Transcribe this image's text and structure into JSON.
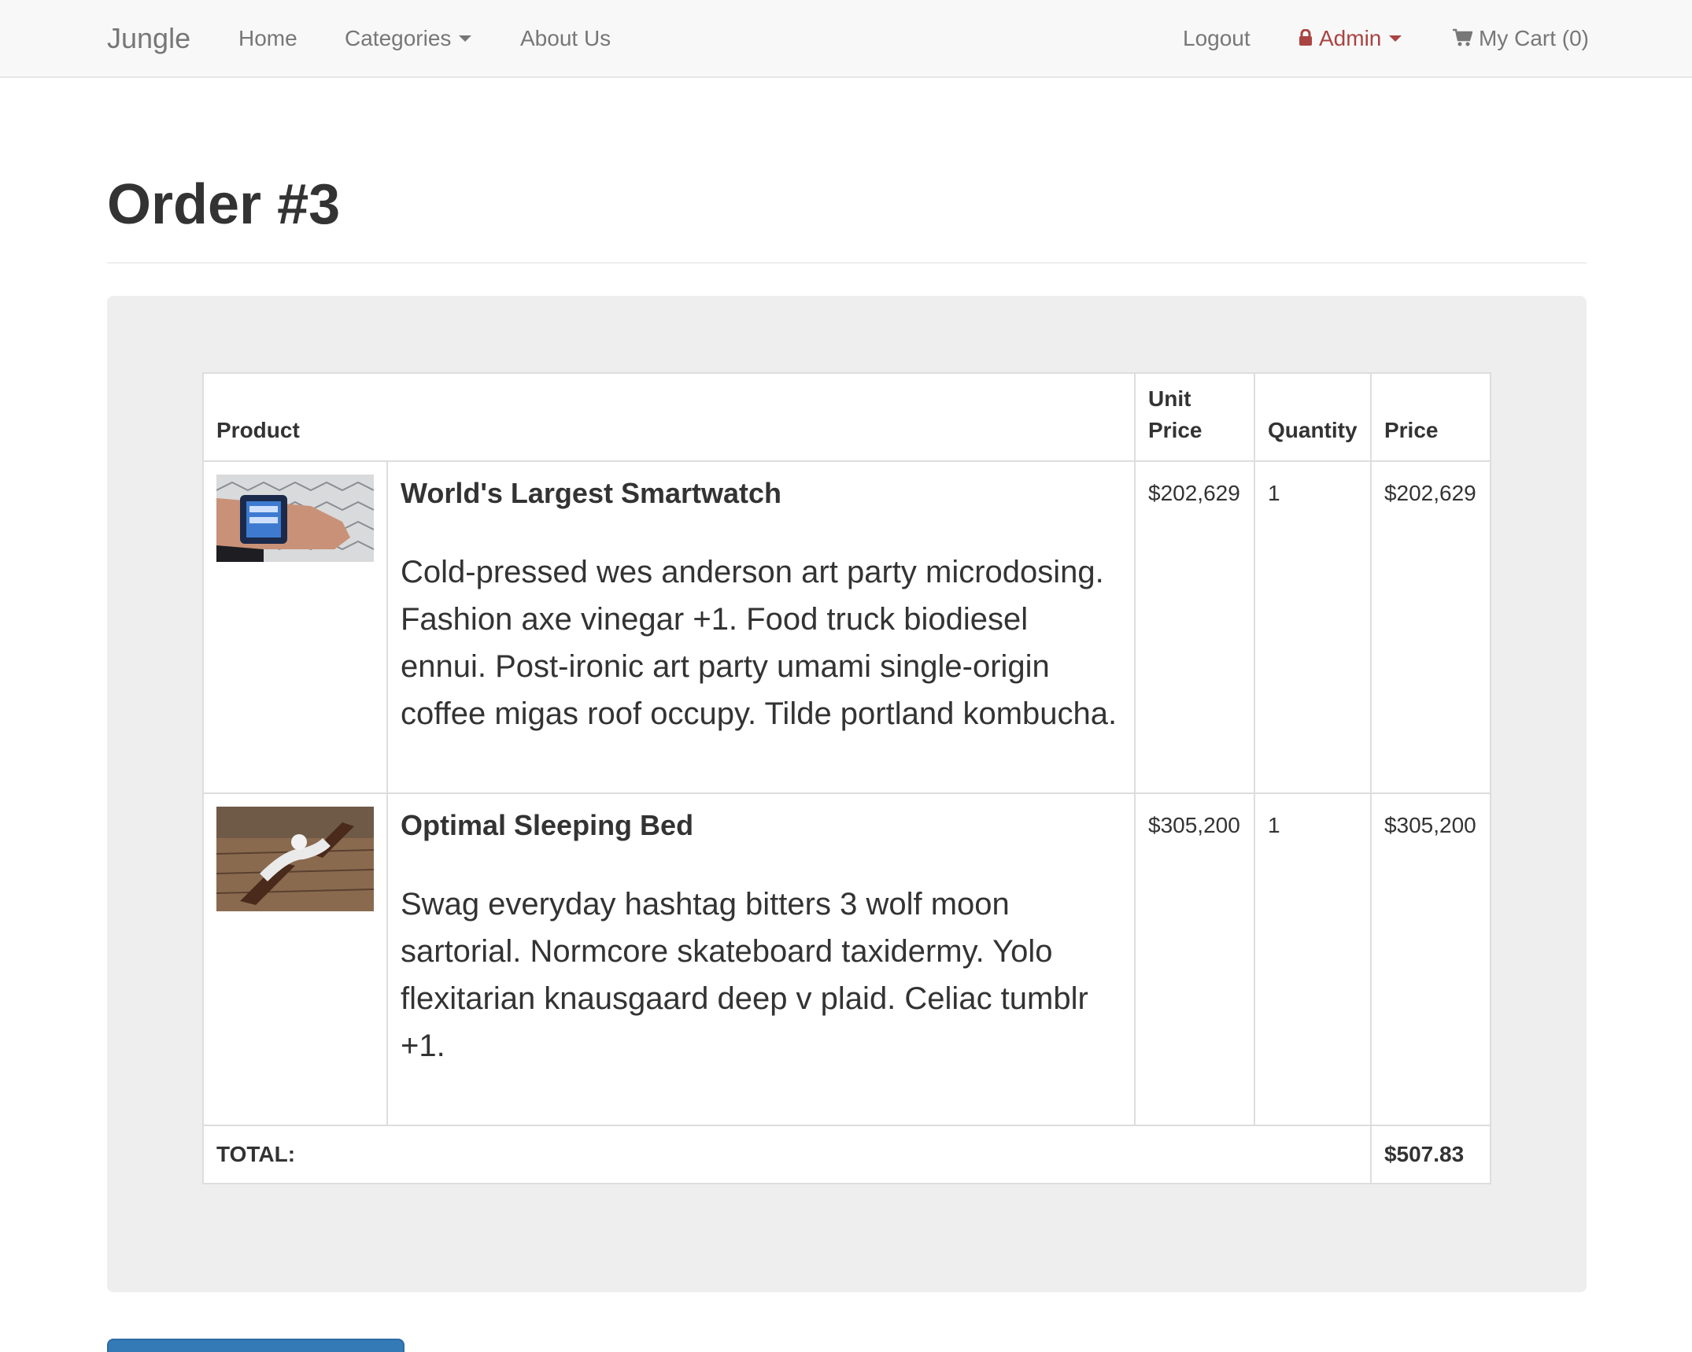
{
  "navbar": {
    "brand": "Jungle",
    "home": "Home",
    "categories": "Categories",
    "about": "About Us",
    "logout": "Logout",
    "admin": "Admin",
    "cart": "My Cart (0)"
  },
  "page": {
    "title": "Order #3"
  },
  "table": {
    "headers": {
      "product": "Product",
      "unit_price_line1": "Unit",
      "unit_price_line2": "Price",
      "quantity": "Quantity",
      "price": "Price"
    },
    "rows": [
      {
        "name": "World's Largest Smartwatch",
        "description": "Cold-pressed wes anderson art party microdosing. Fashion axe vinegar +1. Food truck biodiesel ennui. Post-ironic art party umami single-origin coffee migas roof occupy. Tilde portland kombucha.",
        "unit_price": "$202,629",
        "quantity": "1",
        "price": "$202,629",
        "image_icon": "smartwatch-photo"
      },
      {
        "name": "Optimal Sleeping Bed",
        "description": "Swag everyday hashtag bitters 3 wolf moon sartorial. Normcore skateboard taxidermy. Yolo flexitarian knausgaard deep v plaid. Celiac tumblr +1.",
        "unit_price": "$305,200",
        "quantity": "1",
        "price": "$305,200",
        "image_icon": "bed-photo"
      }
    ],
    "total_label": "TOTAL:",
    "total_value": "$507.83"
  },
  "colors": {
    "navbar_bg": "#f8f8f8",
    "admin_red": "#a94442",
    "well_bg": "#eeeeee",
    "primary_blue": "#337ab7"
  }
}
